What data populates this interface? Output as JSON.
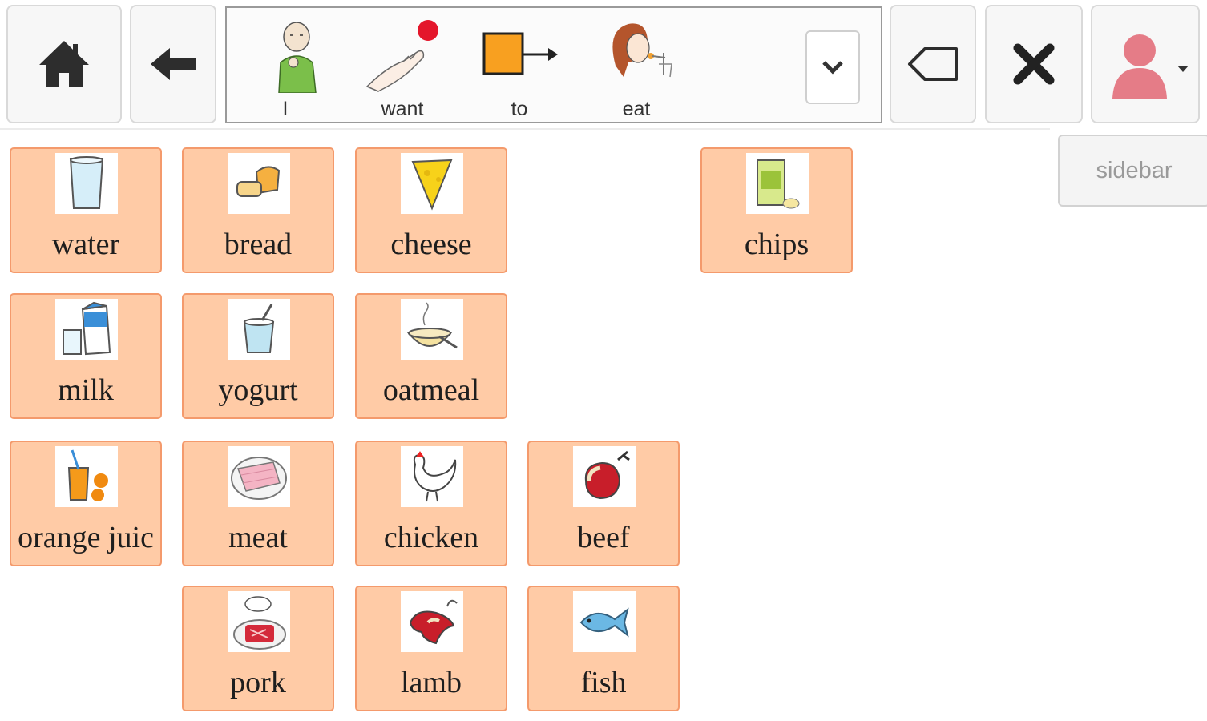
{
  "toolbar": {
    "home_icon": "home-icon",
    "back_icon": "back-arrow-icon",
    "backspace_icon": "backspace-icon",
    "clear_icon": "close-icon",
    "user_icon": "user-avatar-icon",
    "sidebar_label": "sidebar"
  },
  "sentence": {
    "words": [
      {
        "label": "I",
        "icon": "person-pointing-self-icon"
      },
      {
        "label": "want",
        "icon": "want-hand-icon"
      },
      {
        "label": "to",
        "icon": "arrow-to-icon"
      },
      {
        "label": "eat",
        "icon": "eating-icon"
      }
    ],
    "dropdown_icon": "chevron-down-icon"
  },
  "grid": {
    "buttons": [
      {
        "label": "water",
        "icon": "water-glass-icon"
      },
      {
        "label": "bread",
        "icon": "bread-icon"
      },
      {
        "label": "cheese",
        "icon": "cheese-icon"
      },
      {
        "label": "chips",
        "icon": "chips-bag-icon"
      },
      {
        "label": "milk",
        "icon": "milk-carton-icon"
      },
      {
        "label": "yogurt",
        "icon": "yogurt-icon"
      },
      {
        "label": "oatmeal",
        "icon": "oatmeal-bowl-icon"
      },
      {
        "label": "orange juic",
        "icon": "orange-juice-icon"
      },
      {
        "label": "meat",
        "icon": "meat-icon"
      },
      {
        "label": "chicken",
        "icon": "chicken-icon"
      },
      {
        "label": "beef",
        "icon": "beef-icon"
      },
      {
        "label": "pork",
        "icon": "pork-icon"
      },
      {
        "label": "lamb",
        "icon": "lamb-icon"
      },
      {
        "label": "fish",
        "icon": "fish-icon"
      }
    ]
  },
  "colors": {
    "button_fill": "#ffcba6",
    "button_border": "#f49a6c",
    "avatar": "#e57c87"
  }
}
